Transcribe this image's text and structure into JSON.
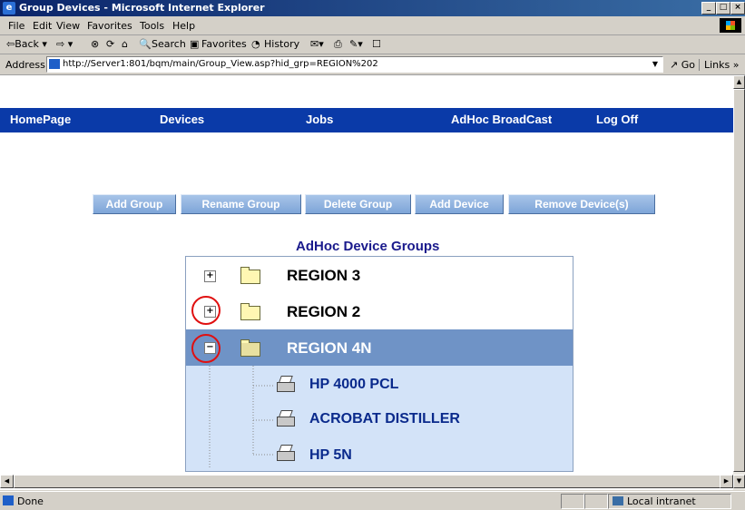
{
  "window": {
    "title": "Group Devices - Microsoft Internet Explorer",
    "controls": [
      "_",
      "□",
      "×"
    ]
  },
  "menu": [
    "File",
    "Edit",
    "View",
    "Favorites",
    "Tools",
    "Help"
  ],
  "toolbar": {
    "back": "⇦Back ▾",
    "forward": "⇨ ▾",
    "search": "Search",
    "favorites": "Favorites",
    "history": "History"
  },
  "address": {
    "label": "Address",
    "url": "http://Server1:801/bqm/main/Group_View.asp?hid_grp=REGION%202",
    "go": "Go",
    "links": "Links »"
  },
  "nav": [
    "HomePage",
    "Devices",
    "Jobs",
    "AdHoc BroadCast",
    "Log Off"
  ],
  "actions": [
    "Add Group",
    "Rename Group",
    "Delete Group",
    "Add Device",
    "Remove Device(s)"
  ],
  "tree": {
    "title": "AdHoc Device Groups",
    "groups": [
      {
        "label": "REGION 3",
        "expander": "+",
        "selected": false
      },
      {
        "label": "REGION 2",
        "expander": "+",
        "selected": false
      },
      {
        "label": "REGION 4N",
        "expander": "−",
        "selected": true
      }
    ],
    "devices": [
      "HP 4000 PCL",
      "ACROBAT DISTILLER",
      "HP 5N"
    ]
  },
  "status": {
    "text": "Done",
    "zone": "Local intranet"
  },
  "colors": {
    "nav_bg": "#0a3aa8",
    "button_bg": "#8fb2e0",
    "selected_row": "#6f93c6",
    "child_bg": "#d3e3f8",
    "highlight": "#e01010"
  }
}
